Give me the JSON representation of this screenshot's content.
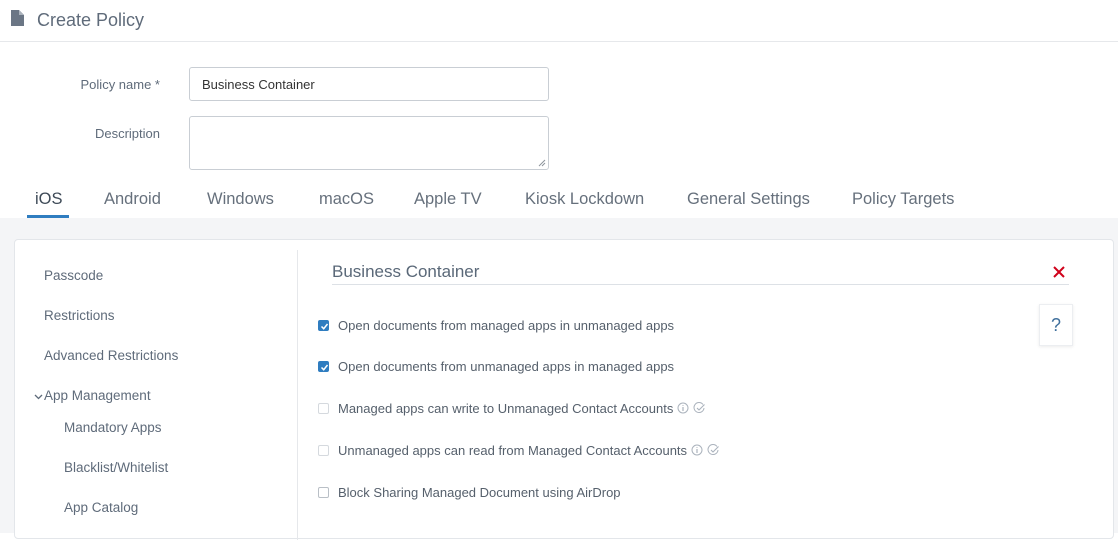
{
  "header": {
    "title": "Create Policy",
    "icon": "document-icon"
  },
  "form": {
    "policy_name_label": "Policy name *",
    "policy_name_value": "Business Container",
    "description_label": "Description",
    "description_value": ""
  },
  "tabs": [
    {
      "label": "iOS",
      "active": true
    },
    {
      "label": "Android",
      "active": false
    },
    {
      "label": "Windows",
      "active": false
    },
    {
      "label": "macOS",
      "active": false
    },
    {
      "label": "Apple TV",
      "active": false
    },
    {
      "label": "Kiosk Lockdown",
      "active": false
    },
    {
      "label": "General Settings",
      "active": false
    },
    {
      "label": "Policy Targets",
      "active": false
    }
  ],
  "sidebar": {
    "items": [
      {
        "label": "Passcode"
      },
      {
        "label": "Restrictions"
      },
      {
        "label": "Advanced Restrictions"
      },
      {
        "label": "App Management",
        "expanded": true
      },
      {
        "label": "Mandatory Apps"
      },
      {
        "label": "Blacklist/Whitelist"
      },
      {
        "label": "App Catalog"
      }
    ]
  },
  "content": {
    "title": "Business Container",
    "help_label": "?",
    "options": [
      {
        "label": "Open documents from managed apps in unmanaged apps",
        "checked": true,
        "enabled": true
      },
      {
        "label": "Open documents from unmanaged apps in managed apps",
        "checked": true,
        "enabled": true
      },
      {
        "label": "Managed apps can write to Unmanaged Contact Accounts",
        "checked": false,
        "enabled": false,
        "info_icon": true,
        "verified_icon": true
      },
      {
        "label": "Unmanaged apps can read from Managed Contact Accounts",
        "checked": false,
        "enabled": false,
        "info_icon": true,
        "verified_icon": true
      },
      {
        "label": "Block Sharing Managed Document using AirDrop",
        "checked": false,
        "enabled": true
      }
    ]
  },
  "colors": {
    "accent": "#2f7dc0",
    "close": "#d0021b",
    "panel_bg": "#f4f5f7"
  }
}
